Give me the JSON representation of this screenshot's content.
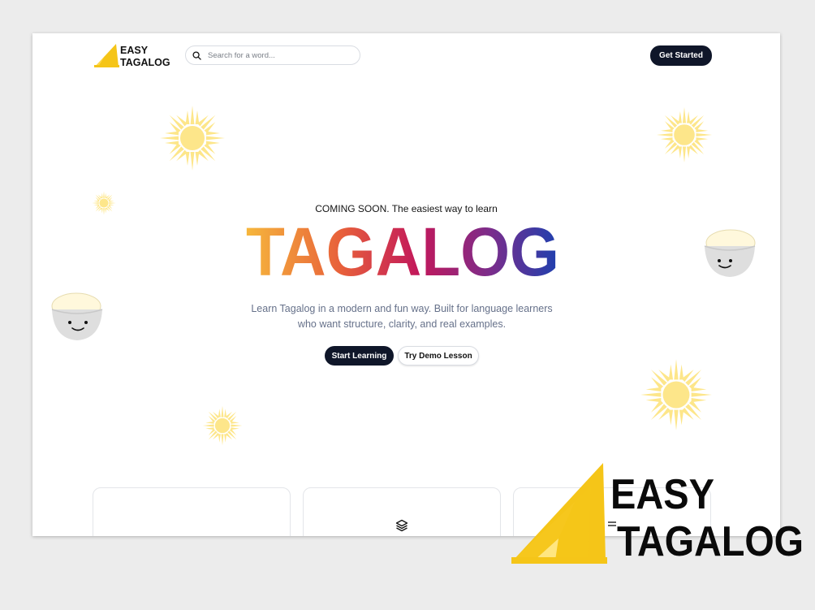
{
  "header": {
    "logo_line1": "EASY",
    "logo_line2": "TAGALOG",
    "search_placeholder": "Search for a word...",
    "cta_label": "Get Started"
  },
  "hero": {
    "eyebrow": "COMING SOON. The easiest way to learn",
    "title": "TAGALOG",
    "subtitle_line1": "Learn Tagalog in a modern and fun way. Built for language learners",
    "subtitle_line2": "who want structure, clarity, and real examples.",
    "primary_button": "Start Learning",
    "secondary_button": "Try Demo Lesson"
  },
  "cards": [
    {
      "icon": "none"
    },
    {
      "icon": "layers-icon"
    },
    {
      "icon": "list-icon"
    }
  ],
  "overlay_logo": {
    "line1": "EASY",
    "line2": "TAGALOG"
  },
  "colors": {
    "sun": "#fde68a",
    "brand_yellow": "#f5c518",
    "dark": "#0f1629",
    "gradient": [
      "#f6b73c",
      "#e8613a",
      "#c2185b",
      "#7b2d8b",
      "#1e40af"
    ]
  }
}
